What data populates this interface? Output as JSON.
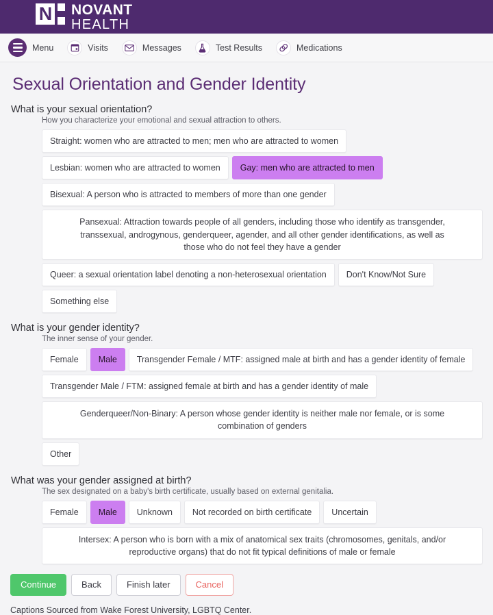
{
  "brand": {
    "logo_letter": "N",
    "name_top": "NOVANT",
    "name_bottom": "HEALTH",
    "registered_mark": "®"
  },
  "nav": {
    "items": [
      {
        "label": "Menu",
        "icon": "hamburger-menu-icon"
      },
      {
        "label": "Visits",
        "icon": "calendar-icon"
      },
      {
        "label": "Messages",
        "icon": "envelope-icon"
      },
      {
        "label": "Test Results",
        "icon": "flask-icon"
      },
      {
        "label": "Medications",
        "icon": "pills-icon"
      }
    ]
  },
  "page": {
    "title": "Sexual Orientation and Gender Identity",
    "footnote": "Captions Sourced from Wake Forest University, LGBTQ Center."
  },
  "questions": [
    {
      "title": "What is your sexual orientation?",
      "help": "How you characterize your emotional and sexual attraction to others.",
      "options": [
        {
          "label": "Straight: women who are attracted to men; men who are attracted to women",
          "selected": false,
          "wide": false
        },
        {
          "label": "Lesbian: women who are attracted to women",
          "selected": false,
          "wide": false
        },
        {
          "label": "Gay: men who are attracted to men",
          "selected": true,
          "wide": false
        },
        {
          "label": "Bisexual: A person who is attracted to members of more than one gender",
          "selected": false,
          "wide": false
        },
        {
          "label": "Pansexual: Attraction towards people of all genders, including those who identify as transgender, transsexual, androgynous, genderqueer, agender, and all other gender identifications, as well as those who do not feel they have a gender",
          "selected": false,
          "wide": true
        },
        {
          "label": "Queer: a sexual orientation label denoting a non-heterosexual orientation",
          "selected": false,
          "wide": false
        },
        {
          "label": "Don't Know/Not Sure",
          "selected": false,
          "wide": false
        },
        {
          "label": "Something else",
          "selected": false,
          "wide": false
        }
      ]
    },
    {
      "title": "What is your gender identity?",
      "help": "The inner sense of your gender.",
      "options": [
        {
          "label": "Female",
          "selected": false,
          "wide": false
        },
        {
          "label": "Male",
          "selected": true,
          "wide": false
        },
        {
          "label": "Transgender Female / MTF: assigned male at birth and has a gender identity of female",
          "selected": false,
          "wide": false
        },
        {
          "label": "Transgender Male / FTM: assigned female at birth and has a gender identity of male",
          "selected": false,
          "wide": false
        },
        {
          "label": "Genderqueer/Non-Binary: A person whose gender identity is neither male nor female, or is some combination of genders",
          "selected": false,
          "wide": true
        },
        {
          "label": "Other",
          "selected": false,
          "wide": false
        }
      ]
    },
    {
      "title": "What was your gender assigned at birth?",
      "help": "The sex designated on a baby's birth certificate, usually based on external genitalia.",
      "options": [
        {
          "label": "Female",
          "selected": false,
          "wide": false
        },
        {
          "label": "Male",
          "selected": true,
          "wide": false
        },
        {
          "label": "Unknown",
          "selected": false,
          "wide": false
        },
        {
          "label": "Not recorded on birth certificate",
          "selected": false,
          "wide": false
        },
        {
          "label": "Uncertain",
          "selected": false,
          "wide": false
        },
        {
          "label": "Intersex: A person who is born with a mix of anatomical sex traits (chromosomes, genitals, and/or reproductive organs) that do not fit typical definitions of male or female",
          "selected": false,
          "wide": true
        }
      ]
    }
  ],
  "footer_buttons": [
    {
      "label": "Continue",
      "style": "primary"
    },
    {
      "label": "Back",
      "style": "default"
    },
    {
      "label": "Finish later",
      "style": "default"
    },
    {
      "label": "Cancel",
      "style": "danger"
    }
  ],
  "colors": {
    "brand_purple": "#4e2a6e",
    "accent_purple": "#5b2d74",
    "selected_chip": "#cc7ef0",
    "continue_green": "#4fc76b",
    "cancel_red": "#e8635f",
    "page_background": "#f4f4f6"
  }
}
